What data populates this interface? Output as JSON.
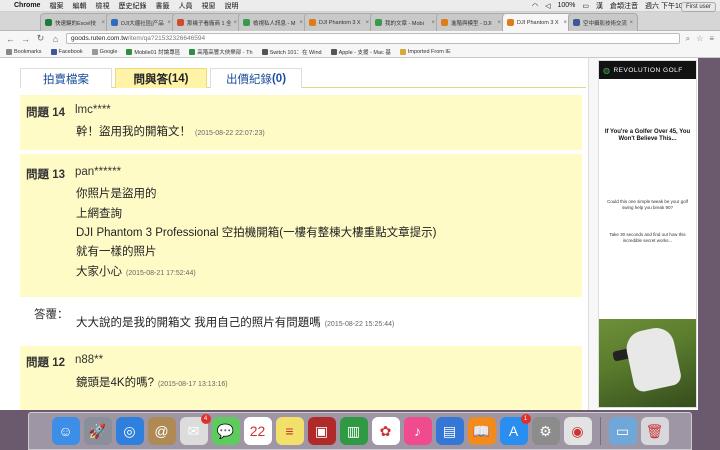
{
  "menubar": {
    "app": "Chrome",
    "items": [
      "檔案",
      "編輯",
      "檢視",
      "歷史紀錄",
      "書籤",
      "人員",
      "視窗",
      "說明"
    ],
    "battery": "100%",
    "input_method": "漢",
    "ime_label": "倉頡注音",
    "clock": "週六 下午10:11"
  },
  "tabs": [
    {
      "label": "快速鍵的Excel技",
      "color": "#1e7c3a"
    },
    {
      "label": "DJI大疆社區[产品",
      "color": "#2d6cc0"
    },
    {
      "label": "那幾子看廠商 1 全",
      "color": "#d24b2d"
    },
    {
      "label": "檢視私人訊息 - M",
      "color": "#3a9a4c"
    },
    {
      "label": "DJI Phantom 3 X",
      "color": "#e07b1a"
    },
    {
      "label": "我的文章 - Mobi",
      "color": "#3a9a4c"
    },
    {
      "label": "進階與模型 - DJI",
      "color": "#e07b1a"
    },
    {
      "label": "DJI Phantom 3 X",
      "color": "#e07b1a",
      "active": true
    },
    {
      "label": "空中攝影技術交流",
      "color": "#3b5998"
    }
  ],
  "first_user": "First user",
  "url": {
    "domain": "goods.ruten.com.tw",
    "path": "/item/qa?21532326646594"
  },
  "bookmarks": [
    {
      "label": "Bookmarks",
      "color": "#888"
    },
    {
      "label": "Facebook",
      "color": "#3b5998"
    },
    {
      "label": "Google",
      "color": "#999"
    },
    {
      "label": "Mobile01 討論專區",
      "color": "#2f8f3f"
    },
    {
      "label": "高階高響大俠樂部 - Th",
      "color": "#2f8f3f"
    },
    {
      "label": "Switch 101：在 Wind",
      "color": "#555"
    },
    {
      "label": "Apple - 支援 - Mac 基",
      "color": "#555"
    },
    {
      "label": "Imported From IE",
      "color": "#d7a83a"
    }
  ],
  "qa_tabs": [
    {
      "label": "拍賣檔案",
      "count": "",
      "active": false
    },
    {
      "label": "問與答",
      "count": "(14)",
      "active": true
    },
    {
      "label": "出價紀錄",
      "count": "(0)",
      "active": false
    }
  ],
  "questions": [
    {
      "num": "問題 14",
      "user": "lmc****",
      "lines": [
        "幹！盜用我的開箱文！"
      ],
      "time": "(2015-08-22 22:07:23)"
    },
    {
      "num": "問題 13",
      "user": "pan******",
      "lines": [
        "你照片是盜用的",
        "上網查詢",
        "DJI Phantom 3 Professional 空拍機開箱(一樓有整棟大樓重點文章提示)",
        "就有一樣的照片",
        "大家小心"
      ],
      "time": "(2015-08-21 17:52:44)"
    },
    {
      "num": "問題 12",
      "user": "n88**",
      "lines": [
        "鏡頭是4K的嗎?"
      ],
      "time": "(2015-08-17 13:13:16)"
    }
  ],
  "answer": {
    "label": "答覆：",
    "text": "大大說的是我的開箱文 我用自己的照片有問題嗎",
    "time": "(2015-08-22 15:25:44)"
  },
  "ad": {
    "brand": "REVOLUTION GOLF",
    "headline": "If You're a Golfer Over 45, You Won't Believe This...",
    "para1": "Could this one simple tweak be your golf swing help you break 90?",
    "para2": "Take 30 seconds and find out how this incredible secret works..."
  },
  "dock": [
    {
      "name": "finder-icon",
      "color": "#3d8ee6",
      "glyph": "☺"
    },
    {
      "name": "launchpad-icon",
      "color": "#8a8f9a",
      "glyph": "🚀"
    },
    {
      "name": "safari-icon",
      "color": "#2f7fdc",
      "glyph": "◎"
    },
    {
      "name": "contacts-icon",
      "color": "#b08a55",
      "glyph": "@"
    },
    {
      "name": "messages-icon",
      "color": "#dcdcdc",
      "glyph": "✉",
      "badge": "4"
    },
    {
      "name": "messages-bubble-icon",
      "color": "#5ecb5e",
      "glyph": "💬"
    },
    {
      "name": "calendar-icon",
      "color": "#ffffff",
      "glyph": "22",
      "dark": true
    },
    {
      "name": "notes-icon",
      "color": "#f2e06b",
      "glyph": "≡",
      "dark": true
    },
    {
      "name": "photobooth-icon",
      "color": "#b02a2a",
      "glyph": "▣"
    },
    {
      "name": "numbers-icon",
      "color": "#2f9a43",
      "glyph": "▥"
    },
    {
      "name": "photos-icon",
      "color": "#ffffff",
      "glyph": "✿",
      "dark": true
    },
    {
      "name": "itunes-icon",
      "color": "#f04b8c",
      "glyph": "♪"
    },
    {
      "name": "keynote-icon",
      "color": "#3477d6",
      "glyph": "▤"
    },
    {
      "name": "ibooks-icon",
      "color": "#f28b1e",
      "glyph": "📖"
    },
    {
      "name": "appstore-icon",
      "color": "#2a8df0",
      "glyph": "A",
      "badge": "1"
    },
    {
      "name": "system-preferences-icon",
      "color": "#8c8c8c",
      "glyph": "⚙"
    },
    {
      "name": "chrome-icon",
      "color": "#e3e3e3",
      "glyph": "◉",
      "dark": true
    },
    {
      "sep": true
    },
    {
      "name": "folder-icon",
      "color": "#6fa7d8",
      "glyph": "▭"
    },
    {
      "name": "trash-icon",
      "color": "#d8d8dc",
      "glyph": "🗑",
      "dark": true
    }
  ]
}
